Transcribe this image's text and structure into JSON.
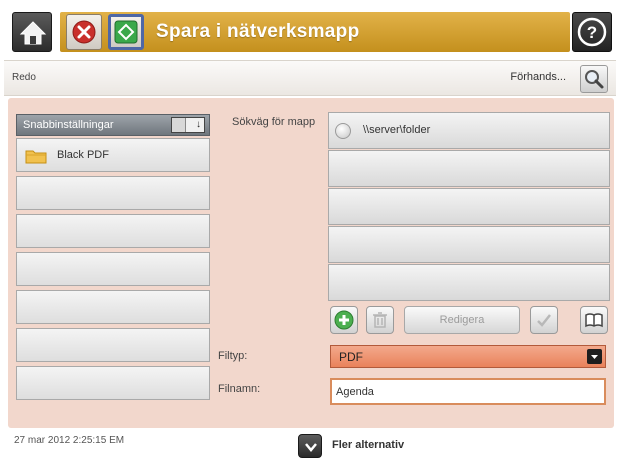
{
  "title_bar": {
    "title": "Spara i nätverksmapp",
    "home_icon": "home-icon",
    "stop_icon": "stop-icon",
    "start_icon": "start-icon",
    "help_icon": "help-icon",
    "colors": {
      "title_strip": "#d3a13a",
      "stop": "#c9302c",
      "start": "#3aa84a"
    }
  },
  "status_bar": {
    "status": "Redo",
    "preview_label": "Förhands...",
    "preview_icon": "magnifier-icon"
  },
  "quick_settings": {
    "header": "Snabbinställningar",
    "sort_icon": "sort-az-icon",
    "items": [
      {
        "label": "Black PDF",
        "icon": "folder-icon"
      },
      {
        "label": ""
      },
      {
        "label": ""
      },
      {
        "label": ""
      },
      {
        "label": ""
      },
      {
        "label": ""
      },
      {
        "label": ""
      }
    ]
  },
  "folder_path": {
    "label": "Sökväg för mapp",
    "entries": [
      "\\\\server\\folder",
      "",
      "",
      "",
      ""
    ]
  },
  "actions": {
    "add_icon": "add-icon",
    "delete_icon": "trash-icon",
    "edit_label": "Redigera",
    "check_icon": "check-icon",
    "addressbook_icon": "address-book-icon"
  },
  "file_type": {
    "label": "Filtyp:",
    "value": "PDF"
  },
  "file_name": {
    "label": "Filnamn:",
    "value": "Agenda"
  },
  "footer": {
    "datetime": "27 mar 2012 2:25:15 EM",
    "more_options": "Fler alternativ",
    "more_icon": "chevron-down-icon"
  }
}
